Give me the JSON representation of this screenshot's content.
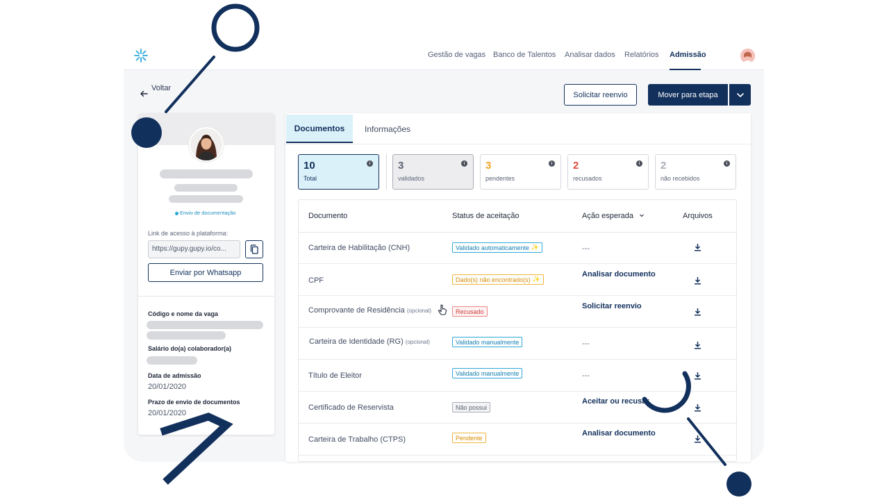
{
  "nav": {
    "items": [
      "Gestão de vagas",
      "Banco de Talentos",
      "Analisar dados",
      "Relatórios",
      "Admissão"
    ],
    "active": "Admissão"
  },
  "header": {
    "back_label": "Voltar",
    "resend_label": "Solicitar reenvio",
    "move_label": "Mover para etapa"
  },
  "profile": {
    "status_text": "Envio de documentação",
    "link_label": "Link de acesso à plataforma:",
    "link_value": "https://gupy.gupy.io/co...",
    "whatsapp_label": "Enviar por Whatsapp",
    "job_label": "Código e nome da vaga",
    "salary_label": "Salário do(a) colaborador(a)",
    "admission_label": "Data de admissão",
    "admission_value": "20/01/2020",
    "deadline_label": "Prazo de envio de documentos",
    "deadline_value": "20/01/2020"
  },
  "tabs": [
    "Documentos",
    "Informações"
  ],
  "stats": [
    {
      "value": "10",
      "label": "Total",
      "color": "#12305c"
    },
    {
      "value": "3",
      "label": "validados",
      "color": "#5a6070"
    },
    {
      "value": "3",
      "label": "pendentes",
      "color": "#f0a52a"
    },
    {
      "value": "2",
      "label": "recusados",
      "color": "#e14a3e"
    },
    {
      "value": "2",
      "label": "não recebidos",
      "color": "#a9adb6"
    }
  ],
  "table": {
    "headers": {
      "doc": "Documento",
      "status": "Status de aceitação",
      "action": "Ação esperada",
      "files": "Arquivos"
    },
    "rows": [
      {
        "doc": "Carteira de Habilitação (CNH)",
        "optional": "",
        "status": "Validado automaticamente",
        "action": "---"
      },
      {
        "doc": "CPF",
        "optional": "",
        "status": "Dado(s) não encontrado(s)",
        "action": "Analisar documento"
      },
      {
        "doc": "Comprovante de Residência",
        "optional": "(opcional)",
        "status": "Recusado",
        "action": "Solicitar reenvio"
      },
      {
        "doc": "Carteira de Identidade (RG)",
        "optional": "(opcional)",
        "status": "Validado manualmente",
        "action": "---"
      },
      {
        "doc": "Título de Eleitor",
        "optional": "",
        "status": "Validado manualmente",
        "action": "---"
      },
      {
        "doc": "Certificado de Reservista",
        "optional": "",
        "status": "Não possui",
        "action": "Aceitar ou recusar"
      },
      {
        "doc": "Carteira de Trabalho (CTPS)",
        "optional": "",
        "status": "Pendente",
        "action": "Analisar documento"
      }
    ]
  },
  "icons": {
    "logo": "snowflake-logo-icon",
    "back": "arrow-left-icon",
    "caret": "chevron-down-icon",
    "copy": "copy-icon",
    "info": "info-icon",
    "sort": "chevron-down-icon",
    "download": "download-icon",
    "cursor": "hand-cursor-icon",
    "sparkle": "sparkle-icon"
  },
  "colors": {
    "brand": "#12305c",
    "accent_light": "#dbf1fa",
    "info_blue": "#2fa8d8",
    "amber": "#f0b43a",
    "red": "#e14a3e"
  }
}
